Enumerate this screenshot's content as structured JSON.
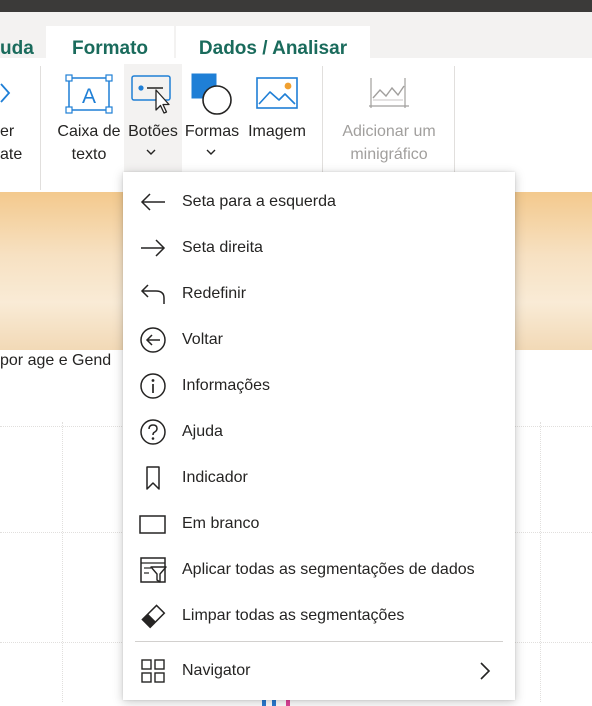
{
  "tabs": [
    {
      "label": "uda",
      "selected": false
    },
    {
      "label": "Formato",
      "selected": true
    },
    {
      "label": "Dados / Analisar",
      "selected": true
    }
  ],
  "ribbon": {
    "partial_left": {
      "line1": "er",
      "line2": "ate"
    },
    "buttons": [
      {
        "line1": "Caixa de",
        "line2": "texto",
        "icon": "text-box-icon"
      },
      {
        "line1": "Botões",
        "line2": "",
        "icon": "buttons-icon",
        "has_dropdown": true
      },
      {
        "line1": "Formas",
        "line2": "",
        "icon": "shapes-icon",
        "has_dropdown": true
      },
      {
        "line1": "Imagem",
        "line2": "",
        "icon": "image-icon"
      },
      {
        "line1": "Adicionar um",
        "line2": "minigráfico",
        "icon": "sparkline-icon",
        "disabled": true
      }
    ]
  },
  "canvas": {
    "chart_title_partial": "por age e Gend"
  },
  "menu": {
    "items": [
      {
        "label": "Seta para a esquerda",
        "icon": "arrow-left-icon"
      },
      {
        "label": "Seta direita",
        "icon": "arrow-right-icon"
      },
      {
        "label": "Redefinir",
        "icon": "reset-icon"
      },
      {
        "label": "Voltar",
        "icon": "back-circle-icon"
      },
      {
        "label": "Informações",
        "icon": "info-icon"
      },
      {
        "label": "Ajuda",
        "icon": "help-icon"
      },
      {
        "label": "Indicador",
        "icon": "bookmark-icon"
      },
      {
        "label": "Em branco",
        "icon": "blank-icon"
      },
      {
        "label": "Aplicar todas as segmentações de dados",
        "icon": "apply-slicers-icon"
      },
      {
        "label": "Limpar todas as segmentações",
        "icon": "clear-slicers-icon"
      }
    ],
    "submenu_item": {
      "label": "Navigator",
      "icon": "navigator-icon",
      "has_submenu": true
    }
  },
  "colors": {
    "tab_text": "#1a6b5c",
    "icon_blue": "#1f7fd6",
    "top_bar": "#3b3a39",
    "banner": "#f5d3a4"
  }
}
